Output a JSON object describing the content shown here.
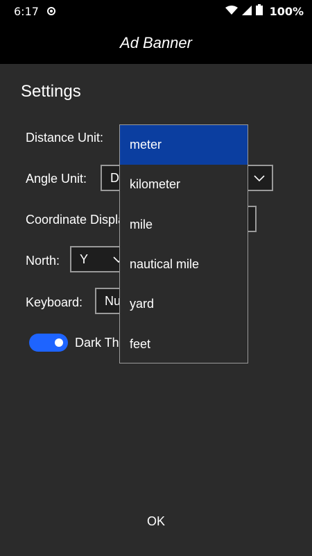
{
  "status_bar": {
    "time": "6:17",
    "battery": "100%",
    "icons": [
      "sync-icon",
      "wifi-icon",
      "signal-icon",
      "battery-icon"
    ]
  },
  "ad_banner": {
    "text": "Ad Banner"
  },
  "dialog": {
    "title": "Settings",
    "rows": {
      "distance_unit": {
        "label": "Distance Unit:"
      },
      "angle_unit": {
        "label": "Angle Unit:",
        "value": "D"
      },
      "coordinate_display": {
        "label": "Coordinate Display"
      },
      "north": {
        "label": "North:",
        "value": "Y"
      },
      "keyboard": {
        "label": "Keyboard:",
        "value": "Nu"
      }
    },
    "dark_theme": {
      "label": "Dark Theme",
      "enabled": true
    },
    "ok_label": "OK"
  },
  "dropdown": {
    "options": [
      "meter",
      "kilometer",
      "mile",
      "nautical mile",
      "yard",
      "feet"
    ],
    "selected": "meter"
  },
  "colors": {
    "background": "#2b2b2b",
    "accent_toggle": "#1e64ff",
    "selected_option": "#0b3ea0",
    "border": "#9a9a9a"
  }
}
